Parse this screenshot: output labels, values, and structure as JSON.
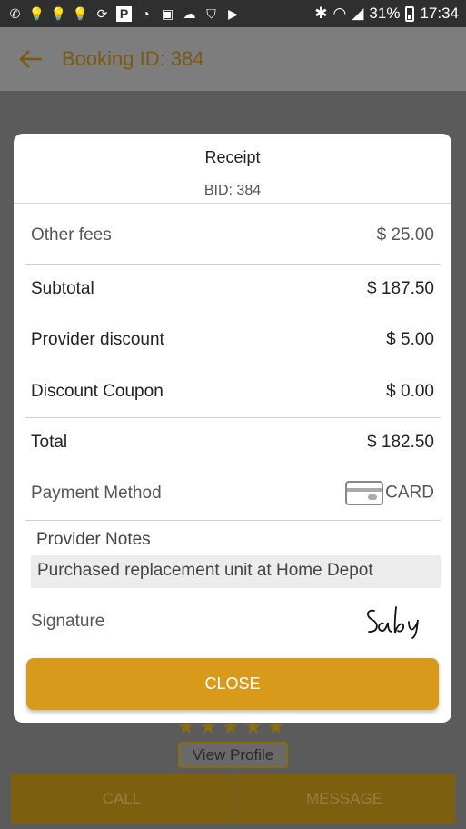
{
  "status_bar": {
    "battery": "31%",
    "time": "17:34",
    "icons": [
      "viber-icon",
      "bulb-icon",
      "bulb-icon",
      "bulb-icon",
      "sync-icon",
      "p-icon",
      "wifi-call-icon",
      "image-icon",
      "cloud-icon",
      "shield-icon",
      "youtube-icon"
    ]
  },
  "app_bar": {
    "title": "Booking ID: 384",
    "back_icon": "arrow-left-icon",
    "accent_color": "#7a5a10"
  },
  "background": {
    "view_profile": "View Profile",
    "call": "CALL",
    "message": "MESSAGE"
  },
  "receipt": {
    "title": "Receipt",
    "bid": "BID: 384",
    "other_fees_label": "Other fees",
    "other_fees_value": "$ 25.00",
    "subtotal_label": "Subtotal",
    "subtotal_value": "$ 187.50",
    "provider_discount_label": "Provider discount",
    "provider_discount_value": "$ 5.00",
    "coupon_label": "Discount Coupon",
    "coupon_value": "$ 0.00",
    "total_label": "Total",
    "total_value": "$ 182.50",
    "payment_label": "Payment Method",
    "payment_value": "CARD",
    "payment_icon": "credit-card-icon",
    "notes_label": "Provider Notes",
    "notes_value": "Purchased replacement unit at Home Depot",
    "signature_label": "Signature",
    "close_label": "CLOSE",
    "close_color": "#d99a1c"
  }
}
